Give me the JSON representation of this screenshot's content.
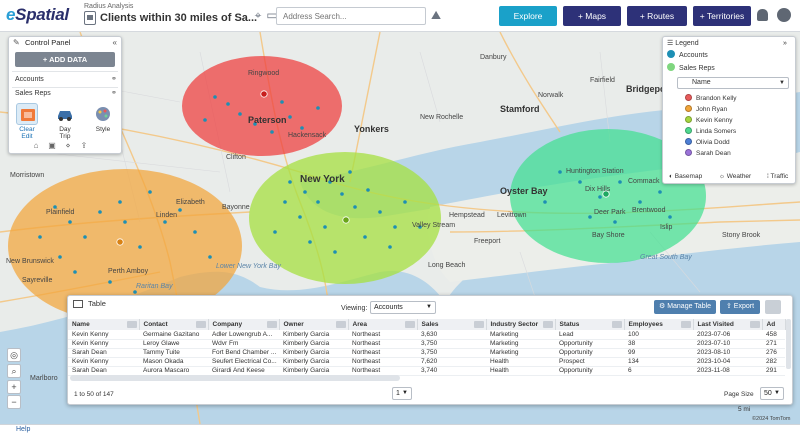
{
  "header": {
    "logo_text_e": "e",
    "logo_text_rest": "Spatial",
    "subtitle": "Radius Analysis",
    "title": "Clients within 30 miles of Sa...",
    "search_placeholder": "Address Search...",
    "nav": {
      "explore": "Explore",
      "maps": "+ Maps",
      "routes": "+ Routes",
      "territories": "+ Territories"
    }
  },
  "control_panel": {
    "title": "Control Panel",
    "add_data": "ADD DATA",
    "layers": [
      "Accounts",
      "Sales Reps"
    ],
    "tools": [
      "Clear Edit",
      "Day Trip",
      "Style"
    ]
  },
  "legend": {
    "title": "Legend",
    "layers": [
      "Accounts",
      "Sales Reps"
    ],
    "group_by": "Name",
    "names": [
      {
        "label": "Brandon Kelly",
        "color": "#e85b5b"
      },
      {
        "label": "John Ryan",
        "color": "#f2a53a"
      },
      {
        "label": "Kevin Kenny",
        "color": "#a6d640"
      },
      {
        "label": "Linda Somers",
        "color": "#4fd98f"
      },
      {
        "label": "Olivia Dodd",
        "color": "#4d7fd6"
      },
      {
        "label": "Sarah Dean",
        "color": "#9b73d9"
      }
    ],
    "footer": [
      "Basemap",
      "Weather",
      "Traffic"
    ]
  },
  "map_labels": {
    "cities": [
      "Ringwood",
      "Paterson",
      "Hackensack",
      "Yonkers",
      "New Rochelle",
      "Stamford",
      "Bridgeport",
      "Huntington Station",
      "Commack",
      "Dix Hills",
      "Deer Park",
      "Brentwood",
      "Bay Shore",
      "Islip",
      "Oyster Bay",
      "Hempstead",
      "Levittown",
      "Freeport",
      "Valley Stream",
      "Long Beach",
      "New York",
      "Plainfield",
      "Elizabeth",
      "Linden",
      "Bayonne",
      "Clifton",
      "Perth Amboy",
      "New Brunswick",
      "Sayreville",
      "Morristown",
      "Marlboro",
      "Stony Brook",
      "Danbury",
      "Norwalk",
      "Fairfield",
      "Lower New York Bay",
      "Raritan Bay",
      "Great South Bay"
    ]
  },
  "table": {
    "title": "Table",
    "viewing_label": "Viewing:",
    "viewing_value": "Accounts",
    "manage_label": "Manage Table",
    "export_label": "Export",
    "columns": [
      "Name",
      "Contact",
      "Company",
      "Owner",
      "Area",
      "Sales",
      "Industry Sector",
      "Status",
      "Employees",
      "Last Visited",
      "Ad"
    ],
    "rows": [
      [
        "Kevin Kenny",
        "Germaine Gazitano",
        "Adler Lowengrub A...",
        "Kimberly Garcia",
        "Northeast",
        "3,630",
        "Marketing",
        "Lead",
        "100",
        "2023-07-06",
        "458"
      ],
      [
        "Kevin Kenny",
        "Leroy Glawe",
        "Wdvr Fm",
        "Kimberly Garcia",
        "Northeast",
        "3,750",
        "Marketing",
        "Opportunity",
        "38",
        "2023-07-10",
        "271"
      ],
      [
        "Sarah Dean",
        "Tammy Tuite",
        "Fort Bend Chamber ...",
        "Kimberly Garcia",
        "Northeast",
        "3,750",
        "Marketing",
        "Opportunity",
        "99",
        "2023-08-10",
        "276"
      ],
      [
        "Kevin Kenny",
        "Mason Okada",
        "Seufert Electrical Co...",
        "Kimberly Garcia",
        "Northeast",
        "7,620",
        "Health",
        "Prospect",
        "134",
        "2023-10-04",
        "282"
      ],
      [
        "Sarah Dean",
        "Aurora Mascaro",
        "Girardi And Keese",
        "Kimberly Garcia",
        "Northeast",
        "3,740",
        "Health",
        "Opportunity",
        "6",
        "2023-11-08",
        "291"
      ]
    ],
    "range_text": "1 to 50 of 147",
    "page_value": "1",
    "page_size_label": "Page Size",
    "page_size_value": "50"
  },
  "footer": {
    "help": "Help",
    "scale": "5 mi",
    "copyright": "©2024 TomTom"
  }
}
